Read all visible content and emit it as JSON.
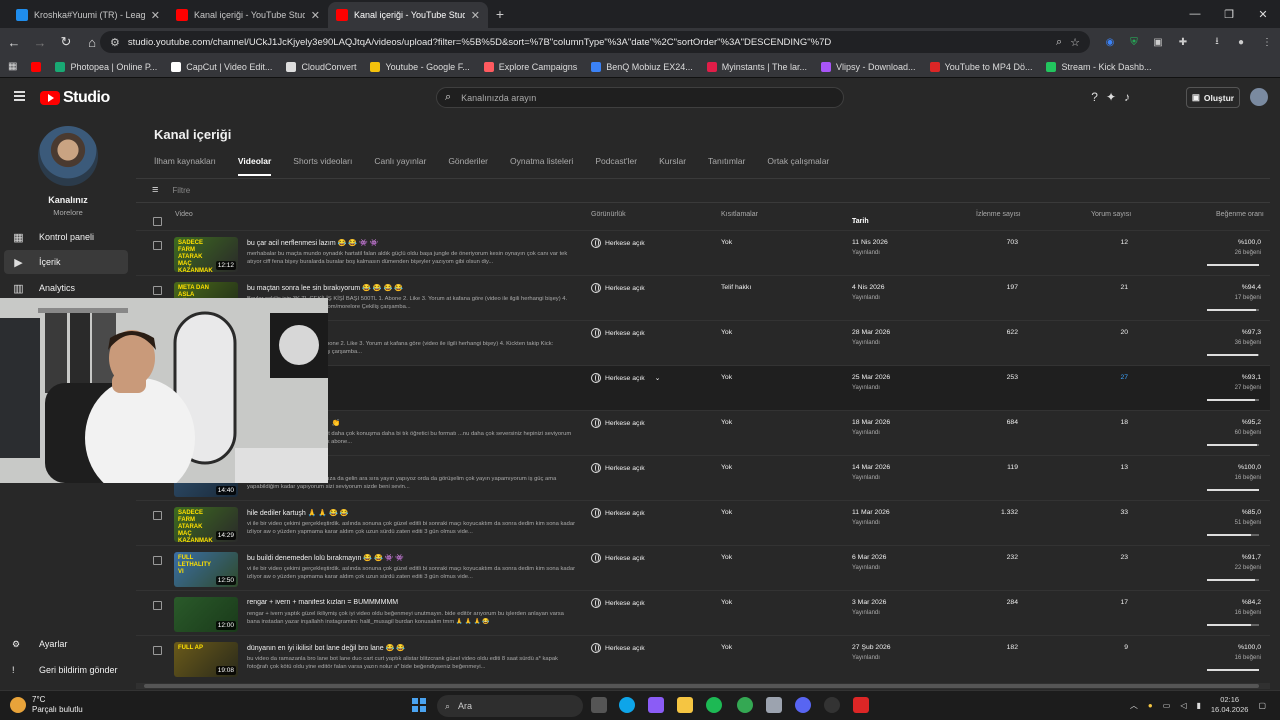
{
  "tabs": [
    {
      "title": "Kroshka#Yuumi (TR) - LeagueO",
      "color": "#1f8ded",
      "active": false
    },
    {
      "title": "Kanal içeriği - YouTube Studio",
      "color": "#ff0000",
      "active": false
    },
    {
      "title": "Kanal içeriği - YouTube Studio",
      "color": "#ff0000",
      "active": true
    }
  ],
  "url": "studio.youtube.com/channel/UCkJ1JcKjyely3e90LAQJtqA/videos/upload?filter=%5B%5D&sort=%7B\"columnType\"%3A\"date\"%2C\"sortOrder\"%3A\"DESCENDING\"%7D",
  "bookmarks": [
    {
      "label": "",
      "color": "#ff0000"
    },
    {
      "label": "Photopea | Online P...",
      "color": "#19a974"
    },
    {
      "label": "CapCut | Video Edit...",
      "color": "#ffffff"
    },
    {
      "label": "CloudConvert",
      "color": "#dddddd"
    },
    {
      "label": "Youtube - Google F...",
      "color": "#f4c20d"
    },
    {
      "label": "Explore Campaigns",
      "color": "#ff5a5f"
    },
    {
      "label": "BenQ Mobiuz EX24...",
      "color": "#3b82f6"
    },
    {
      "label": "Myinstants | The lar...",
      "color": "#e11d48"
    },
    {
      "label": "Vlipsy - Download...",
      "color": "#a855f7"
    },
    {
      "label": "YouTube to MP4 Dö...",
      "color": "#dc2626"
    },
    {
      "label": "Stream - Kick Dashb...",
      "color": "#22c55e"
    }
  ],
  "header": {
    "logo": "Studio",
    "search_placeholder": "Kanalınızda arayın",
    "create": "Oluştur"
  },
  "sidebar": {
    "channel_name": "Kanalınız",
    "channel_sub": "Morelore",
    "items": [
      {
        "label": "Kontrol paneli",
        "icon": "dashboard-icon",
        "active": false
      },
      {
        "label": "İçerik",
        "icon": "content-icon",
        "active": true
      },
      {
        "label": "Analytics",
        "icon": "analytics-icon",
        "active": false
      }
    ],
    "bottom": [
      {
        "label": "Ayarlar",
        "icon": "gear-icon"
      },
      {
        "label": "Geri bildirim gönder",
        "icon": "feedback-icon"
      }
    ]
  },
  "page": {
    "title": "Kanal içeriği",
    "tabs": [
      "İlham kaynakları",
      "Videolar",
      "Shorts videoları",
      "Canlı yayınlar",
      "Gönderiler",
      "Oynatma listeleri",
      "Podcast'ler",
      "Kurslar",
      "Tanıtımlar",
      "Ortak çalışmalar"
    ],
    "active_tab": "Videolar",
    "filter_placeholder": "Filtre",
    "columns": {
      "video": "Video",
      "visibility": "Görünürlük",
      "restrictions": "Kısıtlamalar",
      "date": "Tarih",
      "views": "İzlenme sayısı",
      "comments": "Yorum sayısı",
      "likes": "Beğenme oranı"
    }
  },
  "videos": [
    {
      "title": "bu çar acil nerflenmesi lazım 😂 😂 👾 👾",
      "desc": "merhabalar bu maçta mundo oynadık hartatil falan aldık güçlü oldu başa jungle de öneriyorum kesin oynayın çok canı var tek atıyor ciff fena bişey buralarda buralar boş kalmasın dümenden bişeyler yazıyom gibi olsun diy...",
      "thumb_text": "SADECE FARM ATARAK MAÇ KAZANMAK",
      "duration": "12:12",
      "visibility": "Herkese açık",
      "restriction": "Yok",
      "date": "11 Nis 2026",
      "status": "Yayınlandı",
      "views": "703",
      "comments": "12",
      "ratio": "%100,0",
      "likes": "26 beğeni",
      "fill": 1.0,
      "colors": [
        "#3d6b1f",
        "#2a2a2a"
      ]
    },
    {
      "title": "bu maçtan sonra lee sin bırakıyorum 😂 😂 😂 😂",
      "desc": "Beyler çekiliş için 3K TL ÇEKİLİŞ KİŞİ BAŞI 500TL 1. Abone 2. Like 3. Yorum at kafana göre (video ile ilgili herhangi bişey) 4. Kickten takip Kick: https://kick.com/morelore Çekiliş çarşamba...",
      "thumb_text": "META DAN ASLA DÜŞMEYEN",
      "duration": "",
      "visibility": "Herkese açık",
      "restriction": "Telif hakkı",
      "date": "4 Nis 2026",
      "status": "Yayınlandı",
      "views": "197",
      "comments": "21",
      "ratio": "%94,4",
      "likes": "17 beğeni",
      "fill": 0.944,
      "colors": [
        "#4a6a1a",
        "#1f2a18"
      ]
    },
    {
      "title": "...eçarım 😂 😂",
      "desc": "ÇEKİLİŞ KİŞİ BAŞI 500TL 1. Abone 2. Like 3. Yorum at kafana göre (video ile ilgili herhangi bişey) 4. Kickten takip Kick: https://kick.com/morelore Çekiliş çarşamba...",
      "thumb_text": "",
      "duration": "",
      "visibility": "Herkese açık",
      "restriction": "Yok",
      "date": "28 Mar 2026",
      "status": "Yayınlandı",
      "views": "622",
      "comments": "20",
      "ratio": "%97,3",
      "likes": "36 beğeni",
      "fill": 0.973,
      "colors": [
        "#333",
        "#222"
      ]
    },
    {
      "title": "...edim 👾 👾 👾 👾",
      "desc": "",
      "thumb_text": "",
      "duration": "",
      "visibility": "Herkese açık",
      "restriction": "Yok",
      "date": "25 Mar 2026",
      "status": "Yayınlandı",
      "views": "253",
      "comments": "27",
      "ratio": "%93,1",
      "likes": "27 beğeni",
      "fill": 0.931,
      "colors": [
        "#333",
        "#222"
      ],
      "link": true
    },
    {
      "title": "...öğretici rengar 😂 😂 👏 👏",
      "desc": "...biçimde girdim daha az şitpost daha çok konuşma daha bi tık öğretici bu formatı ...nu daha çok seversiniz hepinizi seviyorum sizde beni sevin video like mayk abone...",
      "thumb_text": "",
      "duration": "",
      "visibility": "Herkese açık",
      "restriction": "Yok",
      "date": "18 Mar 2026",
      "status": "Yayınlandı",
      "views": "684",
      "comments": "18",
      "ratio": "%95,2",
      "likes": "60 beğeni",
      "fill": 0.952,
      "colors": [
        "#333",
        "#222"
      ]
    },
    {
      "title": "... 👾 👾 😂 😂",
      "desc": "...iyi odlu güzel oldu. yayınlarımıza da gelin ara sıra yayın yapıyoz orda da görüşelim çok yayın yapamıyorum iş güç ama yapabildiğim kadar yapıyorum sizi seviyorum sizde beni sevin...",
      "thumb_text": "",
      "duration": "14:40",
      "visibility": "Herkese açık",
      "restriction": "Yok",
      "date": "14 Mar 2026",
      "status": "Yayınlandı",
      "views": "119",
      "comments": "13",
      "ratio": "%100,0",
      "likes": "16 beğeni",
      "fill": 1.0,
      "colors": [
        "#2e4d6a",
        "#1a2a3a"
      ]
    },
    {
      "title": "hile dediler kartuşh 🙏 🙏 😂 😂",
      "desc": "vi ile bir video çekimi gerçekleştirdik. aslında sonuna çok güzel editli bi sonraki maçı koyucaktım da sonra dedim kim sona kadar izliyor aw o yüzden yapmama karar aldım çok uzun sürdü zaten editi 3 gün olmus vide...",
      "thumb_text": "SADECE FARM ATARAK MAÇ KAZANMAK",
      "duration": "14:29",
      "visibility": "Herkese açık",
      "restriction": "Yok",
      "date": "11 Mar 2026",
      "status": "Yayınlandı",
      "views": "1.332",
      "comments": "33",
      "ratio": "%85,0",
      "likes": "51 beğeni",
      "fill": 0.85,
      "colors": [
        "#3d6b1f",
        "#2a2a2a"
      ]
    },
    {
      "title": "bu buildi denemeden lolü bırakmayın 😂 😂 👾 👾",
      "desc": "vi ile bir video çekimi gerçekleştirdik. aslında sonuna çok güzel editli bi sonraki maçı koyucaktım da sonra dedim kim sona kadar izliyor aw o yüzden yapmama karar aldım çok uzun sürdü zaten editi 3 gün olmus vide...",
      "thumb_text": "FULL LETHALITY VI",
      "duration": "12:50",
      "visibility": "Herkese açık",
      "restriction": "Yok",
      "date": "6 Mar 2026",
      "status": "Yayınlandı",
      "views": "232",
      "comments": "23",
      "ratio": "%91,7",
      "likes": "22 beğeni",
      "fill": 0.917,
      "colors": [
        "#3a6ea5",
        "#2f4a2a"
      ]
    },
    {
      "title": "rengar + ivern + manifest kızları = BUMMMMMM",
      "desc": "rengar + ivern yaptık güzel ikiliymiş çok iyi video oldu beğenmeyi unutmayın. bide editör arıyorum bu işlerden anlayan varsa bana instadan yazar inşallahh instagramim: halil_musagil burdan konusalım tmm 🙏 🙏 🙏 😂",
      "thumb_text": "",
      "duration": "12:00",
      "visibility": "Herkese açık",
      "restriction": "Yok",
      "date": "3 Mar 2026",
      "status": "Yayınlandı",
      "views": "284",
      "comments": "17",
      "ratio": "%84,2",
      "likes": "16 beğeni",
      "fill": 0.842,
      "colors": [
        "#2a5a2a",
        "#1a3a1a"
      ]
    },
    {
      "title": "dünyanın en iyi ikilisi! bot lane değil bro lane 😂 😂",
      "desc": "bu video da ramazanla bro lane bot lane duo cart curt yaptık alistar blitzcrank güzel video oldu editi 8 saat sürdü a* kapak fotoğrafı çok kötü oldu yine editör falan varsa yazın nolur a* bide beğendiyseniz beğenmeyi...",
      "thumb_text": "FULL AP",
      "duration": "19:08",
      "visibility": "Herkese açık",
      "restriction": "Yok",
      "date": "27 Şub 2026",
      "status": "Yayınlandı",
      "views": "182",
      "comments": "9",
      "ratio": "%100,0",
      "likes": "16 beğeni",
      "fill": 1.0,
      "colors": [
        "#6a5a1a",
        "#2a2a1a"
      ]
    }
  ],
  "taskbar": {
    "weather_temp": "7°C",
    "weather_desc": "Parçalı bulutlu",
    "search": "Ara",
    "time": "02:16",
    "date": "16.04.2026"
  }
}
